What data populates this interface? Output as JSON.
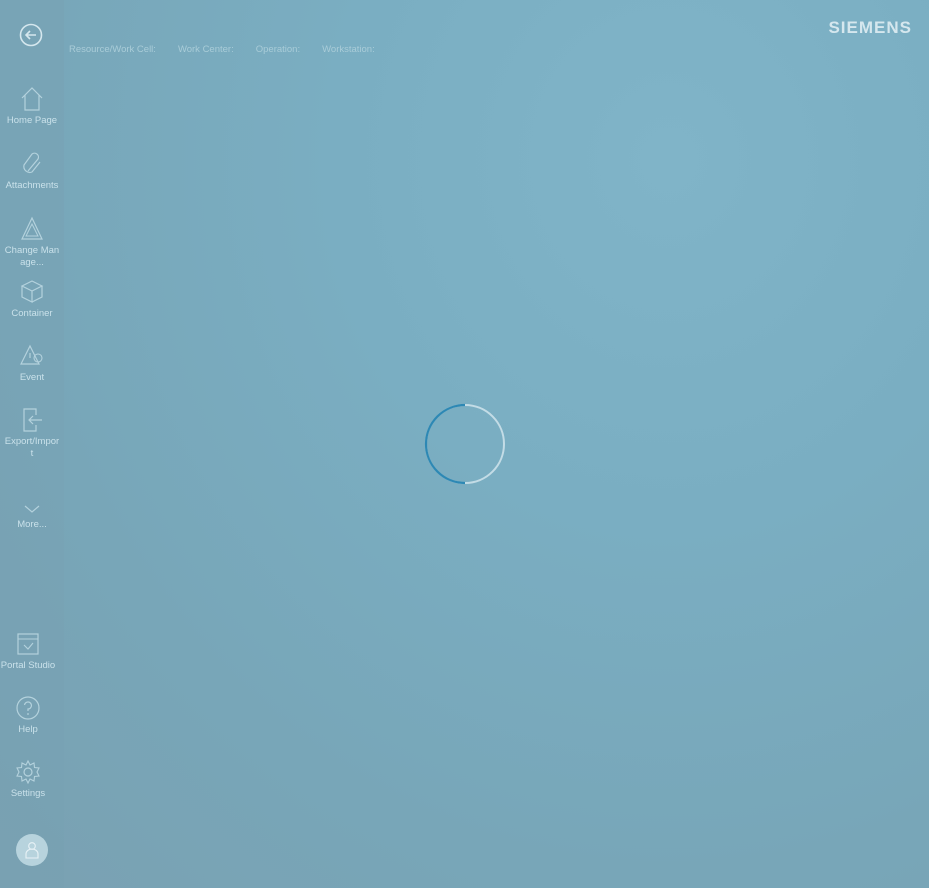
{
  "brand": "SIEMENS",
  "context_bar": {
    "resource": "Resource/Work Cell:",
    "work_center": "Work Center:",
    "operation": "Operation:",
    "workstation": "Workstation:"
  },
  "sidebar": {
    "items": [
      {
        "label": "Home Page",
        "icon": "home-icon"
      },
      {
        "label": "Attachments",
        "icon": "paperclip-icon"
      },
      {
        "label": "Change Manage...",
        "icon": "triangle-icon"
      },
      {
        "label": "Container",
        "icon": "box-icon"
      },
      {
        "label": "Event",
        "icon": "event-icon"
      },
      {
        "label": "Export/Import",
        "icon": "export-import-icon"
      },
      {
        "label": "More...",
        "icon": "chevron-down-icon"
      }
    ],
    "bottom_items": [
      {
        "label": "Portal Studio",
        "icon": "portal-studio-icon"
      },
      {
        "label": "Help",
        "icon": "help-icon"
      },
      {
        "label": "Settings",
        "icon": "gear-icon"
      }
    ]
  },
  "colors": {
    "background": "#7aaec2",
    "spinner_accent": "#2d88b4",
    "text_light": "#c9e1ea"
  }
}
